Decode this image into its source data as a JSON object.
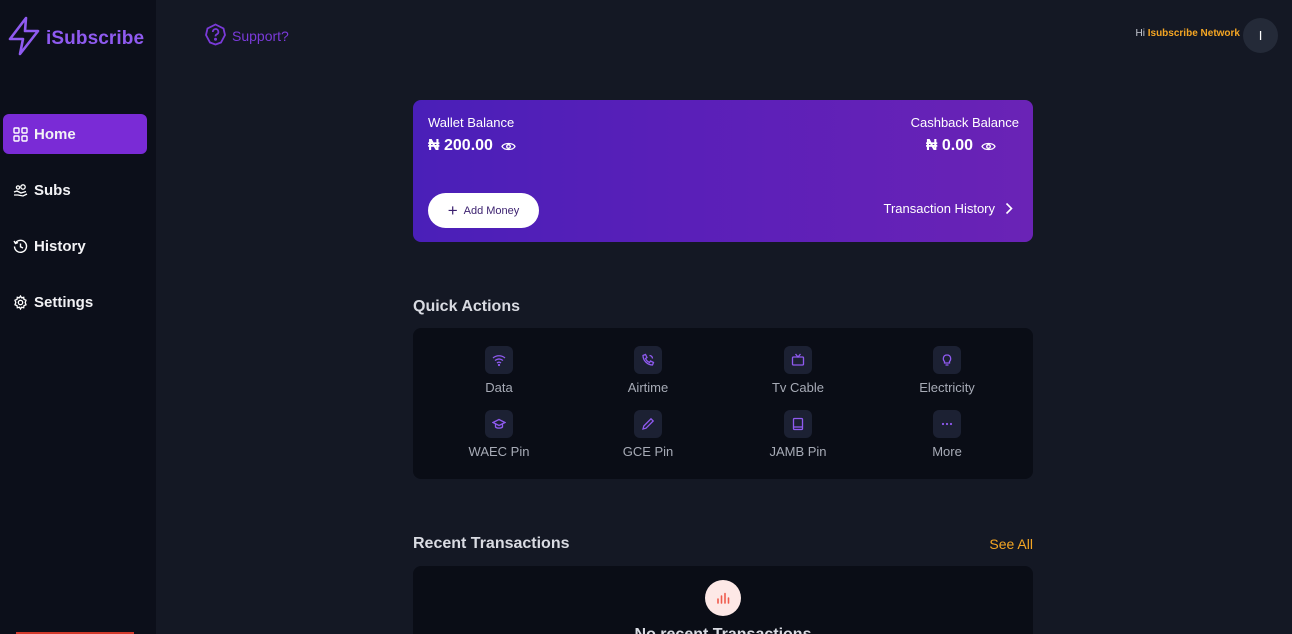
{
  "brand": {
    "name": "iSubscribe",
    "logo_icon": "lightning-bolt-icon"
  },
  "sidebar": {
    "items": [
      {
        "label": "Home",
        "icon": "grid-icon",
        "active": true
      },
      {
        "label": "Subs",
        "icon": "hand-coins-icon",
        "active": false
      },
      {
        "label": "History",
        "icon": "history-icon",
        "active": false
      },
      {
        "label": "Settings",
        "icon": "gear-icon",
        "active": false
      }
    ]
  },
  "header": {
    "support_label": "Support?",
    "greeting_prefix": "Hi",
    "user_name": "Isubscribe Network",
    "avatar_initial": "I"
  },
  "wallet": {
    "wallet_label": "Wallet Balance",
    "wallet_amount": "₦ 200.00",
    "cashback_label": "Cashback Balance",
    "cashback_amount": "₦ 0.00",
    "add_money_label": "Add Money",
    "history_label": "Transaction History"
  },
  "quick_actions": {
    "title": "Quick Actions",
    "items": [
      {
        "label": "Data",
        "icon": "wifi-icon"
      },
      {
        "label": "Airtime",
        "icon": "phone-icon"
      },
      {
        "label": "Tv Cable",
        "icon": "tv-icon"
      },
      {
        "label": "Electricity",
        "icon": "lightbulb-icon"
      },
      {
        "label": "WAEC Pin",
        "icon": "graduation-cap-icon"
      },
      {
        "label": "GCE Pin",
        "icon": "pencil-icon"
      },
      {
        "label": "JAMB Pin",
        "icon": "book-icon"
      },
      {
        "label": "More",
        "icon": "more-dots-icon"
      }
    ]
  },
  "recent": {
    "title": "Recent Transactions",
    "see_all": "See All",
    "empty_text": "No recent Transactions"
  },
  "colors": {
    "accent": "#7a2bd6",
    "highlight": "#f5a623",
    "background": "#141824",
    "sidebar": "#0c0f1a"
  }
}
